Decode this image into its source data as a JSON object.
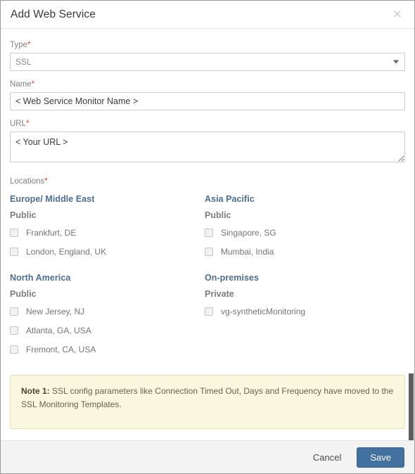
{
  "dialog": {
    "title": "Add Web Service",
    "close_icon": "close-icon"
  },
  "form": {
    "type": {
      "label": "Type",
      "required_marker": "*",
      "value": "SSL",
      "options": [
        "SSL"
      ],
      "arrow_icon": "chevron-down-icon"
    },
    "name": {
      "label": "Name",
      "required_marker": "*",
      "value": "< Web Service Monitor Name >",
      "placeholder": "< Web Service Monitor Name >"
    },
    "url": {
      "label": "URL",
      "required_marker": "*",
      "value": "< Your URL >",
      "placeholder": "< Your URL >"
    }
  },
  "locations": {
    "label": "Locations",
    "required_marker": "*",
    "groups": [
      {
        "region": "Europe/ Middle East",
        "visibility": "Public",
        "items": [
          {
            "name": "Frankfurt, DE",
            "checked": false
          },
          {
            "name": "London, England, UK",
            "checked": false
          }
        ]
      },
      {
        "region": "Asia Pacific",
        "visibility": "Public",
        "items": [
          {
            "name": "Singapore, SG",
            "checked": false
          },
          {
            "name": "Mumbai, India",
            "checked": false
          }
        ]
      },
      {
        "region": "North America",
        "visibility": "Public",
        "items": [
          {
            "name": "New Jersey, NJ",
            "checked": false
          },
          {
            "name": "Atlanta, GA, USA",
            "checked": false
          },
          {
            "name": "Fremont, CA, USA",
            "checked": false
          }
        ]
      },
      {
        "region": "On-premises",
        "visibility": "Private",
        "items": [
          {
            "name": "vg-syntheticMonitoring",
            "checked": false
          }
        ]
      }
    ]
  },
  "note": {
    "prefix": "Note 1:",
    "text": " SSL config parameters like Connection Timed Out, Days and Frequency have moved to the SSL Monitoring Templates."
  },
  "footer": {
    "cancel_label": "Cancel",
    "save_label": "Save"
  },
  "colors": {
    "accent_blue": "#42709f",
    "region_heading": "#4c6f91",
    "required_red": "#e04a32",
    "note_bg": "#faf7df",
    "note_border": "#e6dfb4",
    "footer_bg": "#f3f3f3"
  }
}
